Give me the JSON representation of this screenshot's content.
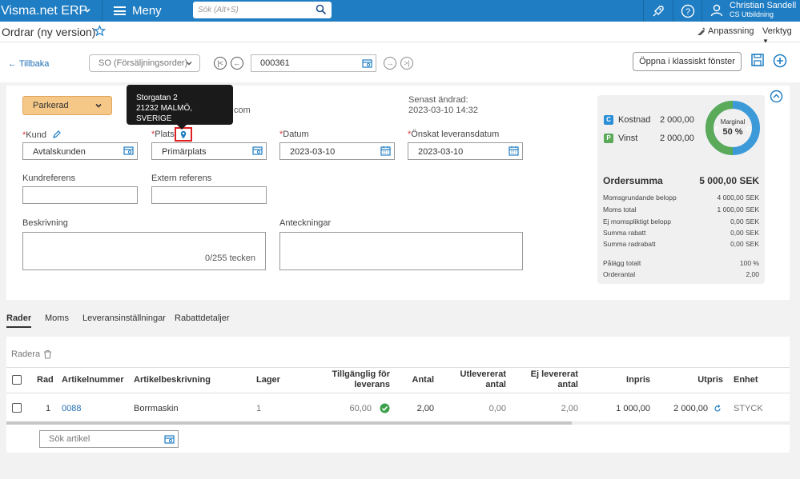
{
  "topbar": {
    "brand": "Visma.net ERP",
    "menu_label": "Meny",
    "search_placeholder": "Sök (Alt+S)",
    "user_name": "Christian Sandell",
    "user_company": "CS Utbildning"
  },
  "titlebar": {
    "title": "Ordrar (ny version)",
    "customize": "Anpassning",
    "tools": "Verktyg"
  },
  "actions": {
    "back": "Tillbaka",
    "order_type": "SO (Försäljningsorder)",
    "order_number": "000361",
    "open_classic": "Öppna i klassiskt fönster"
  },
  "header": {
    "status": "Parkerad",
    "partial_text": ".com",
    "last_changed_label": "Senast ändrad:",
    "last_changed_value": "2023-03-10 14:32",
    "customer_label": "Kund",
    "customer_value": "Avtalskunden",
    "location_label": "Plats",
    "location_value": "Primärplats",
    "date_label": "Datum",
    "date_value": "2023-03-10",
    "requested_label": "Önskat leveransdatum",
    "requested_value": "2023-03-10",
    "customer_ref_label": "Kundreferens",
    "external_ref_label": "Extern referens",
    "description_label": "Beskrivning",
    "description_counter": "0/255 tecken",
    "notes_label": "Anteckningar"
  },
  "tooltip": {
    "line1": "Storgatan 2",
    "line2": "21232 MALMÖ, SVERIGE"
  },
  "summary": {
    "cost_label": "Kostnad",
    "cost_value": "2 000,00",
    "profit_label": "Vinst",
    "profit_value": "2 000,00",
    "margin_label": "Marginal",
    "margin_value": "50 %",
    "margin_fraction": 0.5,
    "order_sum_label": "Ordersumma",
    "order_sum_value": "5 000,00 SEK",
    "rows": [
      {
        "label": "Momsgrundande belopp",
        "value": "4 000,00 SEK"
      },
      {
        "label": "Moms total",
        "value": "1 000,00 SEK"
      },
      {
        "label": "Ej momspliktigt belopp",
        "value": "0,00 SEK"
      },
      {
        "label": "Summa rabatt",
        "value": "0,00 SEK"
      },
      {
        "label": "Summa radrabatt",
        "value": "0,00 SEK"
      }
    ],
    "markup_label": "Pålägg totalt",
    "markup_value": "100 %",
    "order_qty_label": "Orderantal",
    "order_qty_value": "2,00"
  },
  "tabs": [
    "Rader",
    "Moms",
    "Leveransinställningar",
    "Rabattdetaljer"
  ],
  "grid": {
    "delete_label": "Radera",
    "columns": {
      "rad": "Rad",
      "artnr": "Artikelnummer",
      "artdesc": "Artikelbeskrivning",
      "lager": "Lager",
      "avail1": "Tillgänglig för",
      "avail2": "leverans",
      "antal": "Antal",
      "utlev1": "Utlevererat",
      "utlev2": "antal",
      "ejlev1": "Ej levererat",
      "ejlev2": "antal",
      "inpris": "Inpris",
      "utpris": "Utpris",
      "enhet": "Enhet"
    },
    "row": {
      "rad": "1",
      "artnr": "0088",
      "artdesc": "Borrmaskin",
      "lager": "1",
      "avail": "60,00",
      "antal": "2,00",
      "utlev": "0,00",
      "ejlev": "2,00",
      "inpris": "1 000,00",
      "utpris": "2 000,00",
      "enhet": "STYCK"
    },
    "article_search_placeholder": "Sök artikel"
  }
}
